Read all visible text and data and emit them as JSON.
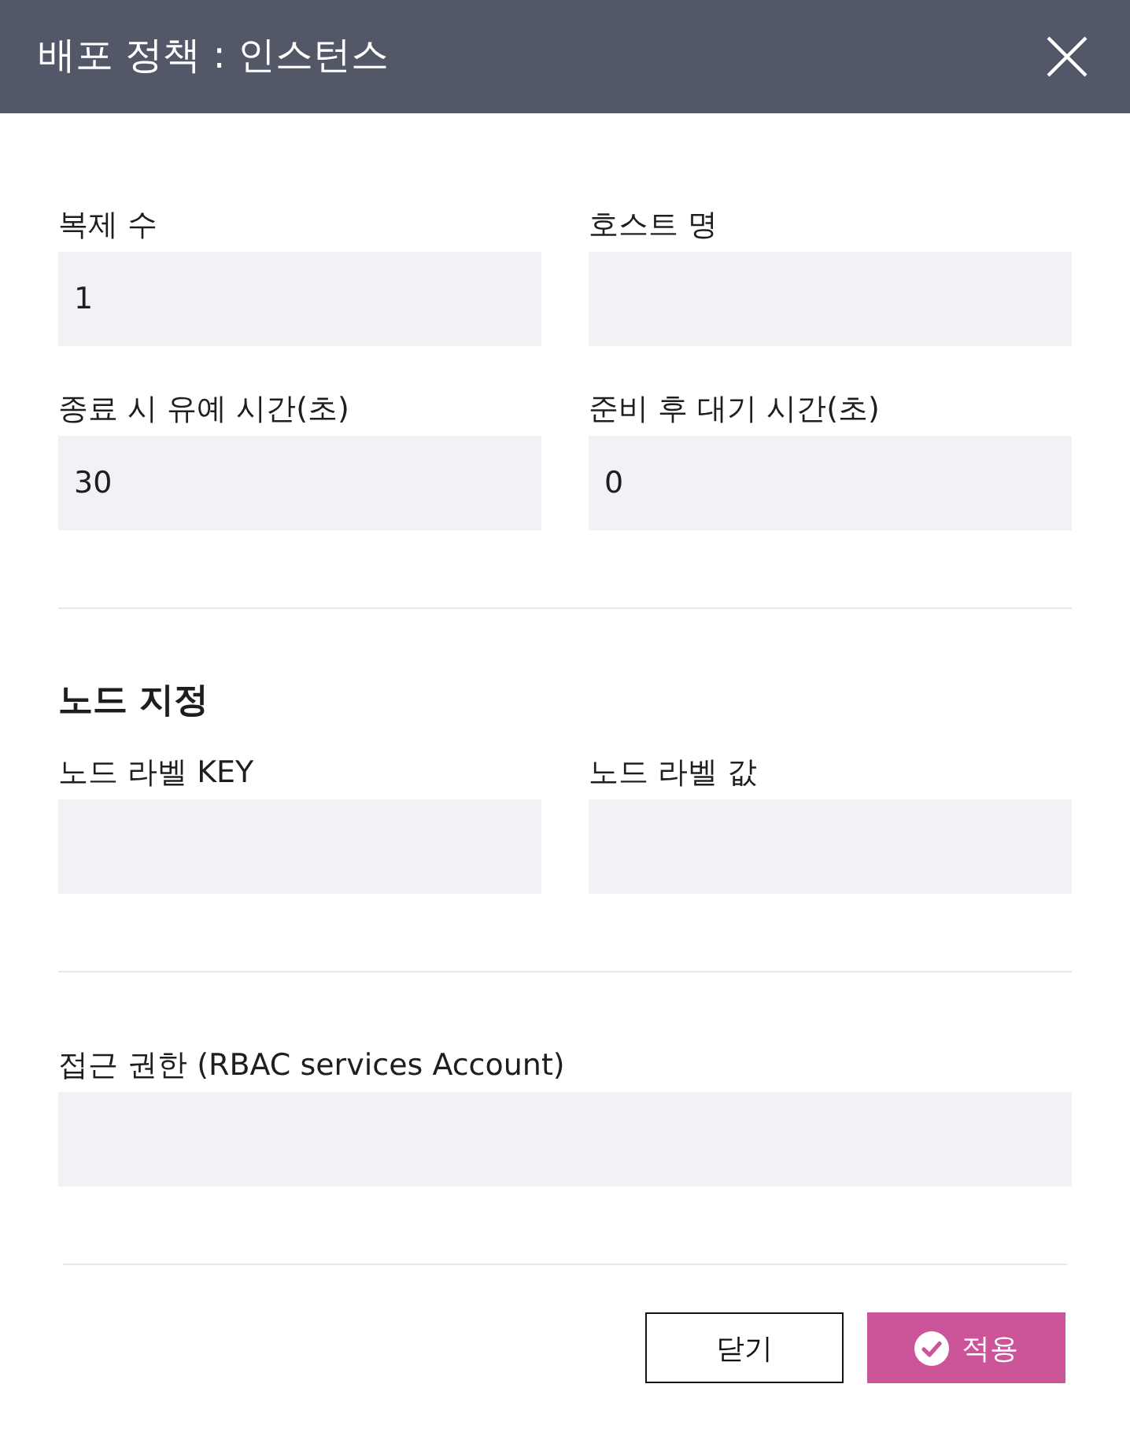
{
  "dialog": {
    "title": "배포 정책 : 인스턴스"
  },
  "sections": [
    {
      "fields": [
        {
          "label": "복제 수",
          "value": "1"
        },
        {
          "label": "호스트 명"
        },
        {
          "label": "종료 시 유예 시간(초)",
          "value": "30"
        },
        {
          "label": "준비 후 대기 시간(초)",
          "value": "0"
        }
      ]
    },
    {
      "heading": "노드 지정",
      "fields": [
        {
          "label": "노드 라벨 KEY"
        },
        {
          "label": "노드 라벨 값"
        }
      ]
    },
    {
      "fields": [
        {
          "label": "접근 권한 (RBAC services Account)"
        }
      ]
    }
  ],
  "buttons": [
    {
      "label": "닫기",
      "kind": "secondary"
    },
    {
      "label": "적용",
      "kind": "primary"
    }
  ]
}
